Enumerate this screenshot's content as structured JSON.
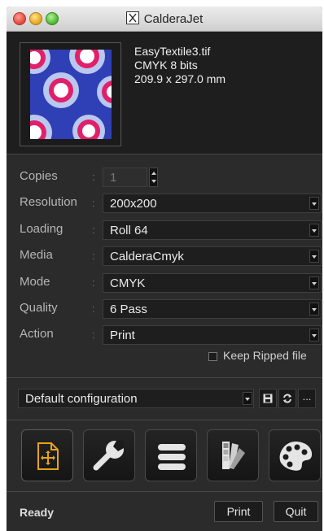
{
  "window": {
    "title": "CalderaJet"
  },
  "file": {
    "name": "EasyTextile3.tif",
    "color_info": "CMYK 8 bits",
    "size": "209.9 x 297.0 mm"
  },
  "settings": {
    "copies": {
      "label": "Copies",
      "value": "1"
    },
    "resolution": {
      "label": "Resolution",
      "value": "200x200"
    },
    "loading": {
      "label": "Loading",
      "value": "Roll 64"
    },
    "media": {
      "label": "Media",
      "value": "CalderaCmyk"
    },
    "mode": {
      "label": "Mode",
      "value": "CMYK"
    },
    "quality": {
      "label": "Quality",
      "value": "6 Pass"
    },
    "action": {
      "label": "Action",
      "value": "Print"
    },
    "separator": ":"
  },
  "keep_ripped": {
    "label": "Keep Ripped file",
    "checked": false
  },
  "configuration": {
    "value": "Default configuration",
    "more_label": "..."
  },
  "tools": [
    "position-tool",
    "wrench-tool",
    "stack-tool",
    "swatch-tool",
    "palette-tool"
  ],
  "status": {
    "text": "Ready"
  },
  "buttons": {
    "print": "Print",
    "quit": "Quit"
  },
  "colors": {
    "accent": "#e8a317",
    "background": "#2b2b2b",
    "thumbnail_blue": "#2f3fb5",
    "thumbnail_pink": "#e0206a",
    "thumbnail_light": "#b9c8ee"
  }
}
